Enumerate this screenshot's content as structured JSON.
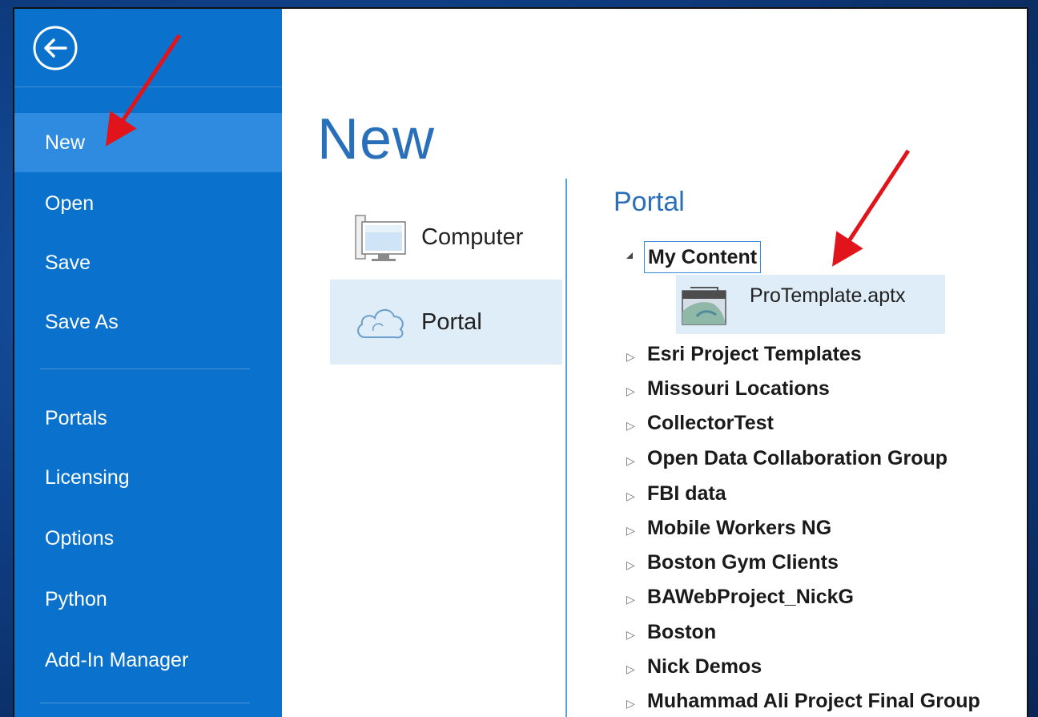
{
  "sidebar": {
    "back_icon": "back-arrow-circle-icon",
    "items": [
      {
        "label": "New",
        "active": true
      },
      {
        "label": "Open"
      },
      {
        "label": "Save"
      },
      {
        "label": "Save As"
      },
      {
        "label": "Portals"
      },
      {
        "label": "Licensing"
      },
      {
        "label": "Options"
      },
      {
        "label": "Python"
      },
      {
        "label": "Add-In Manager"
      }
    ]
  },
  "main": {
    "title": "New",
    "locations": [
      {
        "label": "Computer",
        "icon": "computer-monitor-icon"
      },
      {
        "label": "Portal",
        "icon": "cloud-icon",
        "selected": true
      }
    ],
    "portal": {
      "title": "Portal",
      "root": {
        "label": "My Content",
        "expanded": true
      },
      "file": {
        "name": "ProTemplate.aptx",
        "icon": "project-template-icon"
      },
      "groups": [
        "Esri Project Templates",
        "Missouri Locations",
        "CollectorTest",
        "Open Data Collaboration Group",
        "FBI data",
        "Mobile Workers NG",
        "Boston Gym Clients",
        "BAWebProject_NickG",
        "Boston",
        "Nick Demos",
        "Muhammad Ali Project Final Group"
      ]
    }
  },
  "colors": {
    "sidebar": "#0a72cc",
    "sidebar_active": "#2e8be0",
    "accent": "#2a6fba",
    "selection": "#deedf8",
    "annotation_arrow": "#e0141a"
  }
}
